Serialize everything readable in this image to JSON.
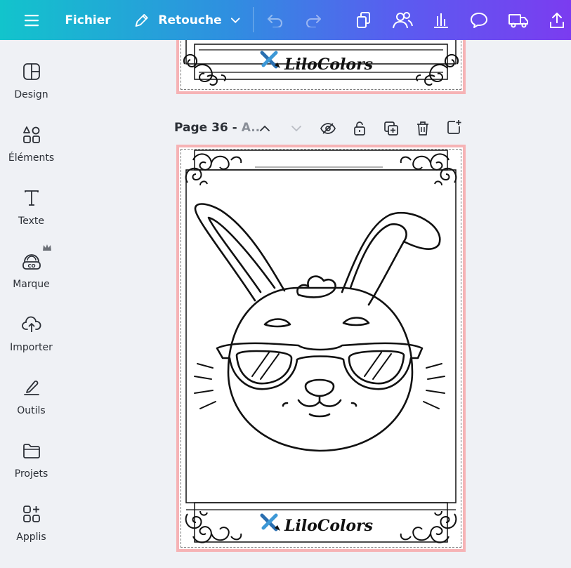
{
  "toolbar": {
    "file_label": "Fichier",
    "edit_label": "Retouche",
    "icons": [
      "menu-icon",
      "pencil-icon",
      "chevron-down-icon",
      "undo-icon",
      "redo-icon",
      "copy-icon",
      "share-people-icon",
      "chart-icon",
      "comment-icon",
      "truck-icon",
      "upload-icon"
    ]
  },
  "sidebar": {
    "items": [
      {
        "label": "Design",
        "icon": "layout-icon"
      },
      {
        "label": "Éléments",
        "icon": "elements-icon"
      },
      {
        "label": "Texte",
        "icon": "text-icon"
      },
      {
        "label": "Marque",
        "icon": "brand-icon"
      },
      {
        "label": "Importer",
        "icon": "cloud-upload-icon"
      },
      {
        "label": "Outils",
        "icon": "tools-icon"
      },
      {
        "label": "Projets",
        "icon": "folder-icon"
      },
      {
        "label": "Applis",
        "icon": "apps-icon"
      }
    ]
  },
  "page": {
    "title": "Page 36 -",
    "subtitle": "A..",
    "logo_text": "LiloColors"
  },
  "colors": {
    "accent_start": "#12c4cc",
    "accent_end": "#7b3cf0",
    "page_border": "#f6b3b5"
  }
}
